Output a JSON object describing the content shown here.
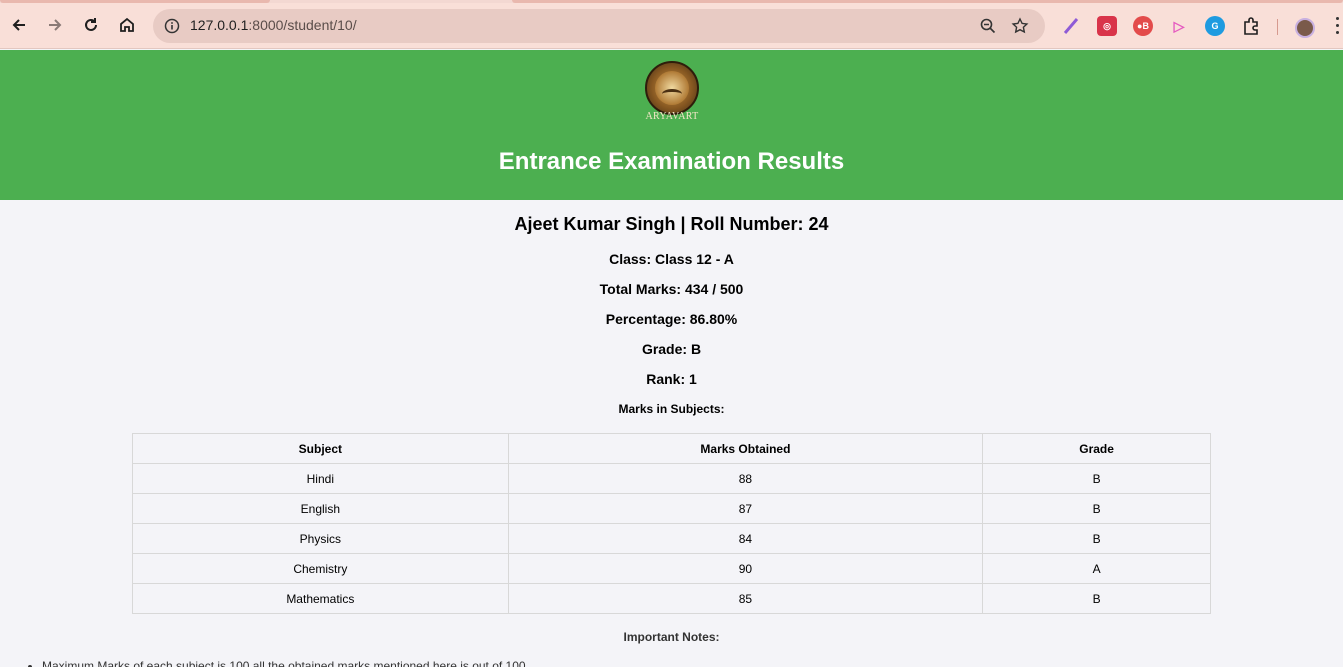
{
  "browser": {
    "url_host": "127.0.0.1",
    "url_path": ":8000/student/10/"
  },
  "header": {
    "logo_text": "ARYAVART",
    "title": "Entrance Examination Results",
    "background": "#4caf50"
  },
  "student": {
    "heading": "Ajeet Kumar Singh | Roll Number: 24",
    "class_line": "Class: Class 12 - A",
    "total_line": "Total Marks: 434 / 500",
    "percentage_line": "Percentage: 86.80%",
    "grade_line": "Grade: B",
    "rank_line": "Rank: 1"
  },
  "marks_heading": "Marks in Subjects:",
  "table": {
    "headers": [
      "Subject",
      "Marks Obtained",
      "Grade"
    ],
    "rows": [
      [
        "Hindi",
        "88",
        "B"
      ],
      [
        "English",
        "87",
        "B"
      ],
      [
        "Physics",
        "84",
        "B"
      ],
      [
        "Chemistry",
        "90",
        "A"
      ],
      [
        "Mathematics",
        "85",
        "B"
      ]
    ]
  },
  "notes": {
    "heading": "Important Notes:",
    "items": [
      "Maximum Marks of each subject is 100 all the obtained marks mentioned here is out of 100"
    ]
  }
}
